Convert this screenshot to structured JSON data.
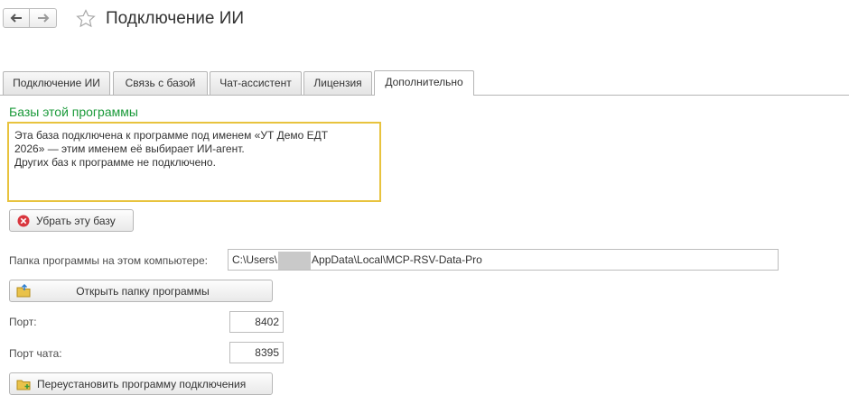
{
  "window": {
    "title": "Подключение ИИ"
  },
  "nav": {
    "back_icon": "arrow-left-icon",
    "forward_icon": "arrow-right-icon",
    "favorite_icon": "star-icon"
  },
  "tabs": [
    {
      "label": "Подключение ИИ",
      "active": false
    },
    {
      "label": "Связь с базой",
      "active": false
    },
    {
      "label": "Чат-ассистент",
      "active": false
    },
    {
      "label": "Лицензия",
      "active": false
    },
    {
      "label": "Дополнительно",
      "active": true
    }
  ],
  "bases": {
    "title": "Базы этой программы",
    "line1": "Эта база подключена к программе под именем «УТ Демо ЕДТ",
    "line2": "2026» — этим именем её выбирает ИИ-агент.",
    "line3": "Других баз к программе не подключено.",
    "remove_button": "Убрать эту базу"
  },
  "folder": {
    "label": "Папка программы на этом компьютере:",
    "path_prefix": "C:\\Users\\",
    "path_suffix": "AppData\\Local\\MCP-RSV-Data-Pro",
    "open_button": "Открыть папку программы"
  },
  "port": {
    "label": "Порт:",
    "value": "8402"
  },
  "chat_port": {
    "label": "Порт чата:",
    "value": "8395"
  },
  "reinstall_button": "Переустановить программу подключения",
  "colors": {
    "group_title": "#1a9a3a",
    "infobox_border": "#e8c33e",
    "remove_icon": "#d9363e",
    "folder_icon": "#e9c24a"
  }
}
